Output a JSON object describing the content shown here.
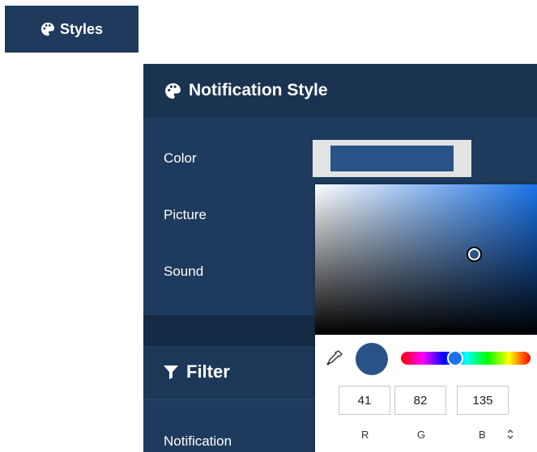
{
  "tab": {
    "label": "Styles",
    "icon": "palette-icon"
  },
  "panel": {
    "title": "Notification Style",
    "icon": "palette-icon",
    "rows": [
      {
        "label": "Color"
      },
      {
        "label": "Picture"
      },
      {
        "label": "Sound"
      }
    ]
  },
  "filter": {
    "title": "Filter",
    "icon": "funnel-icon",
    "first_row_label": "Notification"
  },
  "color_picker": {
    "current_color": "#295287",
    "hue_color": "#1a73e8",
    "r_value": "41",
    "g_value": "82",
    "b_value": "135",
    "r_label": "R",
    "g_label": "G",
    "b_label": "B",
    "mode_toggle_icon": "updown-icon",
    "eyedropper_icon": "eyedropper-icon"
  },
  "colors": {
    "panel_bg": "#1e3a5c",
    "header_bg": "#1a3351",
    "accent": "#1a73e8"
  }
}
